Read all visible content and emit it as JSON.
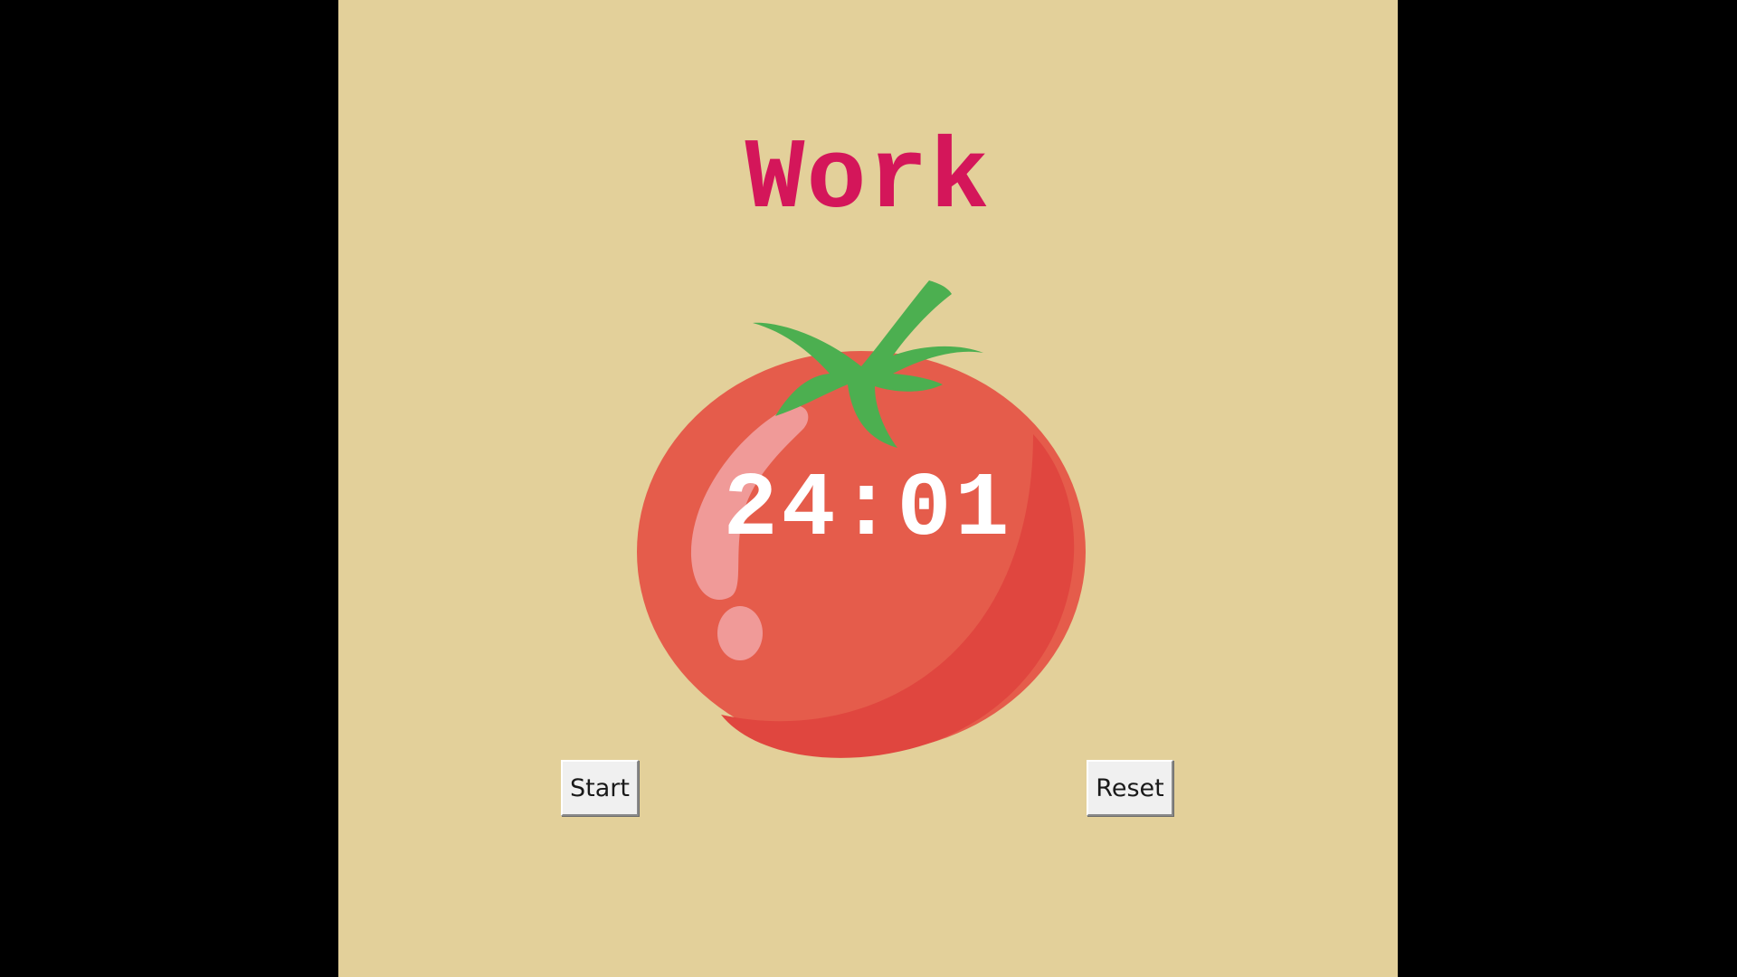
{
  "app": {
    "heading": "Work",
    "timer_display": "24:01"
  },
  "buttons": {
    "start_label": "Start",
    "reset_label": "Reset"
  },
  "colors": {
    "background": "#e3d09a",
    "heading": "#d4165a",
    "tomato_body": "#e55c4b",
    "tomato_shade": "#e0463f",
    "tomato_leaf": "#4caf50",
    "timer_text": "#ffffff",
    "letterbox": "#000000"
  },
  "icons": {
    "tomato": "tomato-icon"
  }
}
